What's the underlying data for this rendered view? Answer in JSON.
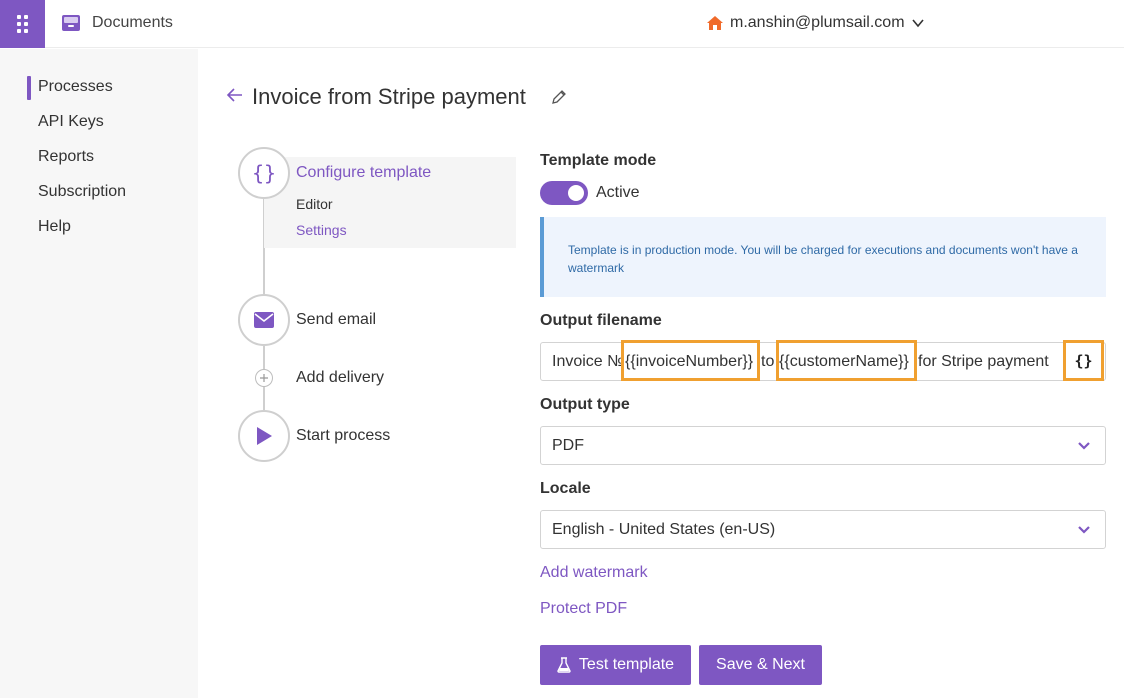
{
  "header": {
    "app_name": "Documents",
    "user_email": "m.anshin@plumsail.com"
  },
  "sidebar": {
    "items": [
      {
        "label": "Processes",
        "active": true
      },
      {
        "label": "API Keys"
      },
      {
        "label": "Reports"
      },
      {
        "label": "Subscription"
      },
      {
        "label": "Help"
      }
    ]
  },
  "page": {
    "title": "Invoice from Stripe payment"
  },
  "steps": {
    "configure": {
      "label": "Configure template",
      "icon": "{}"
    },
    "editor": "Editor",
    "settings": "Settings",
    "send_email": "Send email",
    "add_delivery": "Add delivery",
    "start_process": "Start process"
  },
  "form": {
    "template_mode": {
      "label": "Template mode",
      "state": "Active",
      "on": true
    },
    "info_text": "Template is in production mode. You will be charged for executions and documents won't have a watermark",
    "output_filename": {
      "label": "Output filename",
      "seg1": "Invoice №",
      "token1": "{{invoiceNumber}}",
      "seg2": "to",
      "token2": "{{customerName}}",
      "seg3": "for Stripe payment",
      "token_button": "{}"
    },
    "output_type": {
      "label": "Output type",
      "value": "PDF"
    },
    "locale": {
      "label": "Locale",
      "value": "English - United States (en-US)"
    },
    "add_watermark": "Add watermark",
    "protect_pdf": "Protect PDF",
    "test_button": "Test template",
    "save_button": "Save & Next"
  },
  "colors": {
    "accent": "#7e57c2",
    "highlight": "#f0a030",
    "info_bg": "#eef4fd",
    "info_text": "#2f6aa6",
    "home_icon": "#f06a2a"
  }
}
